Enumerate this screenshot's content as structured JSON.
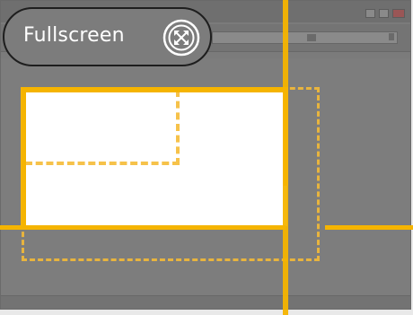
{
  "overlay": {
    "fullscreen_label": "Fullscreen",
    "fullscreen_icon": "fullscreen-expand-icon"
  },
  "colors": {
    "accent": "#f5b400",
    "accent_dashed": "#f6c24a",
    "dim_background": "#7b7b7b",
    "pill_border": "#1e1e1e",
    "selection_fill": "#ffffff"
  }
}
